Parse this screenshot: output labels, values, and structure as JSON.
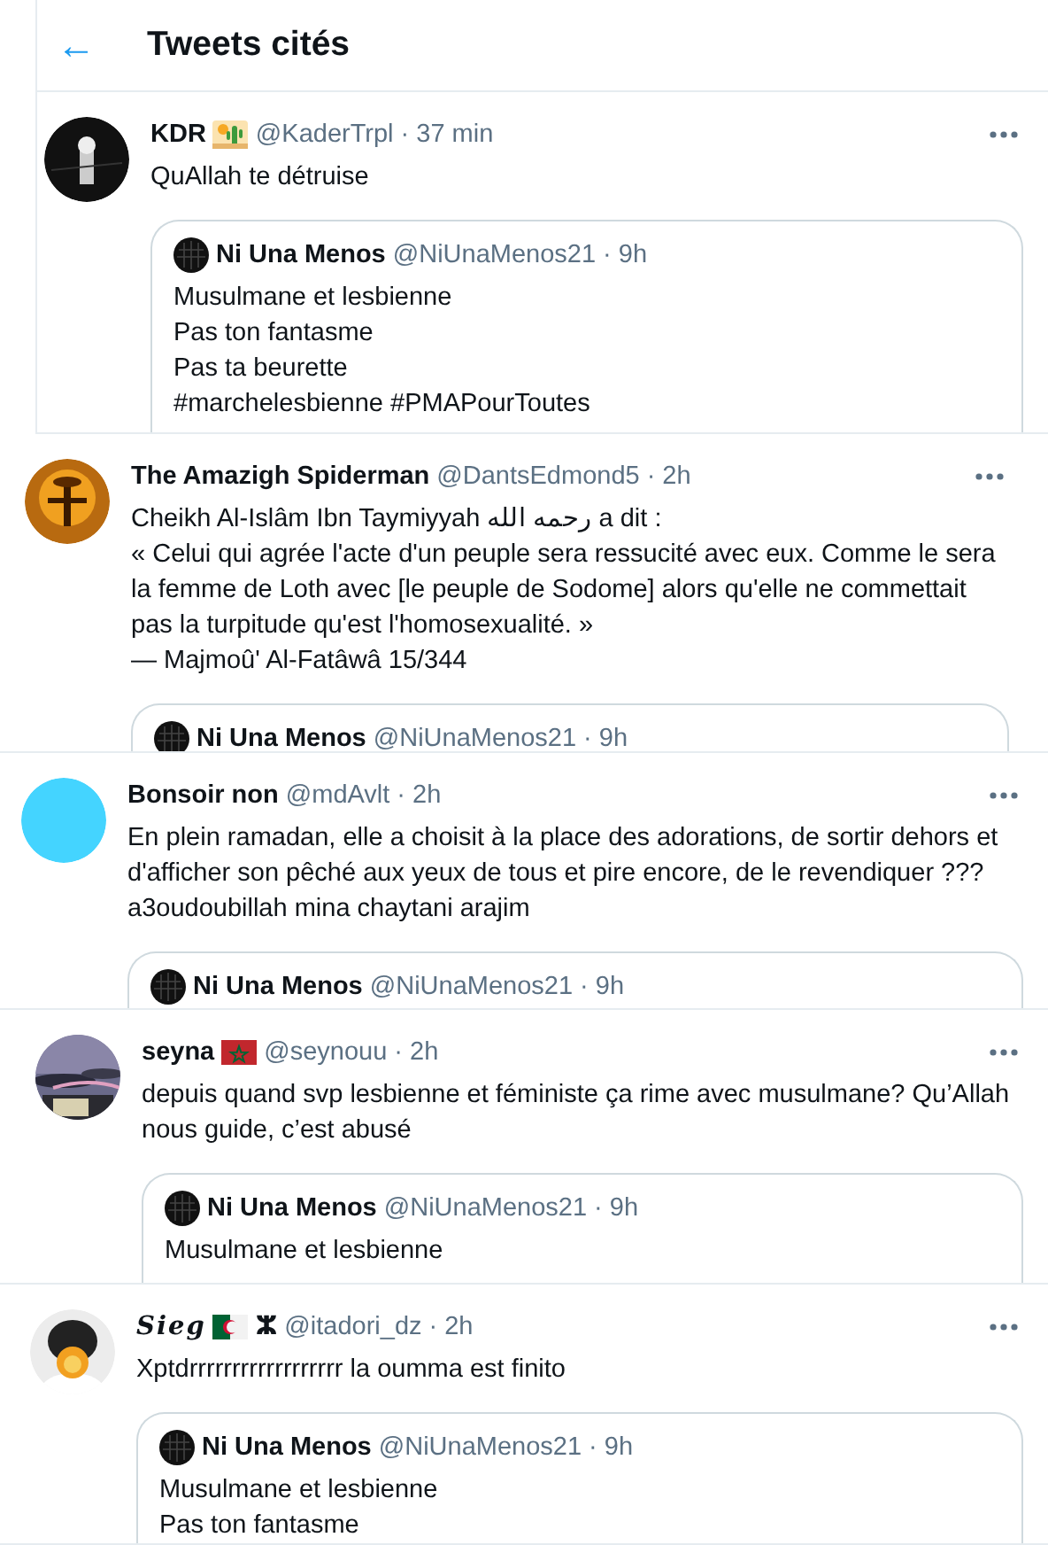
{
  "header": {
    "back": "←",
    "title": "Tweets cités"
  },
  "tweets": [
    {
      "avatar": {
        "kind": "picture"
      },
      "name": "KDR",
      "name_icons": [
        {
          "kind": "desert"
        }
      ],
      "handle": "@KaderTrpl",
      "time": "· 37 min",
      "text": [
        "QuAllah te détruise"
      ],
      "quote": {
        "name": "Ni Una Menos",
        "handle": "@NiUnaMenos21",
        "time": "· 9h",
        "text": [
          "Musulmane et lesbienne",
          "Pas ton fantasme",
          "Pas ta beurette",
          "#marchelesbienne #PMAPourToutes"
        ]
      }
    },
    {
      "avatar": {
        "kind": "picture"
      },
      "name": "The Amazigh Spiderman",
      "handle": "@DantsEdmond5",
      "time": "· 2h",
      "text": [
        "Cheikh Al-Islâm Ibn Taymiyyah رحمه الله a dit :",
        "« Celui qui agrée l'acte d'un peuple sera ressucité avec eux. Comme le sera la femme de Loth avec [le peuple de Sodome] alors qu'elle ne commettait pas la turpitude qu'est l'homosexualité. »",
        "— Majmoû' Al-Fatâwâ 15/344"
      ],
      "quote": {
        "name": "Ni Una Menos",
        "handle": "@NiUnaMenos21",
        "time": "· 9h"
      }
    },
    {
      "avatar": {
        "kind": "plain",
        "color": "#44d4ff"
      },
      "name": "Bonsoir non",
      "handle": "@mdAvlt",
      "time": "· 2h",
      "text": [
        "En plein ramadan, elle a choisit à la place des adorations, de sortir dehors et d'afficher son pêché aux yeux de tous et pire encore, de le revendiquer ???",
        "a3oudoubillah mina chaytani arajim"
      ],
      "quote": {
        "name": "Ni Una Menos",
        "handle": "@NiUnaMenos21",
        "time": "· 9h"
      }
    },
    {
      "avatar": {
        "kind": "picture"
      },
      "name": "seyna",
      "name_icons": [
        {
          "kind": "flag_morocco"
        }
      ],
      "handle": "@seynouu",
      "time": "· 2h",
      "text": [
        "depuis quand svp lesbienne et féministe ça rime avec musulmane? Qu’Allah nous guide, c’est abusé"
      ],
      "quote": {
        "name": "Ni Una Menos",
        "handle": "@NiUnaMenos21",
        "time": "· 9h",
        "text": [
          "Musulmane et lesbienne"
        ]
      }
    },
    {
      "avatar": {
        "kind": "picture"
      },
      "name": "Sieg",
      "name_italic": true,
      "name_icons": [
        {
          "kind": "flag_algeria"
        }
      ],
      "name_suffix": "ⵣ",
      "handle": "@itadori_dz",
      "time": "· 2h",
      "text": [
        "Xptdrrrrrrrrrrrrrrrrrr la oumma est finito"
      ],
      "quote": {
        "name": "Ni Una Menos",
        "handle": "@NiUnaMenos21",
        "time": "· 9h",
        "text": [
          "Musulmane et lesbienne",
          "Pas ton fantasme"
        ]
      }
    }
  ]
}
